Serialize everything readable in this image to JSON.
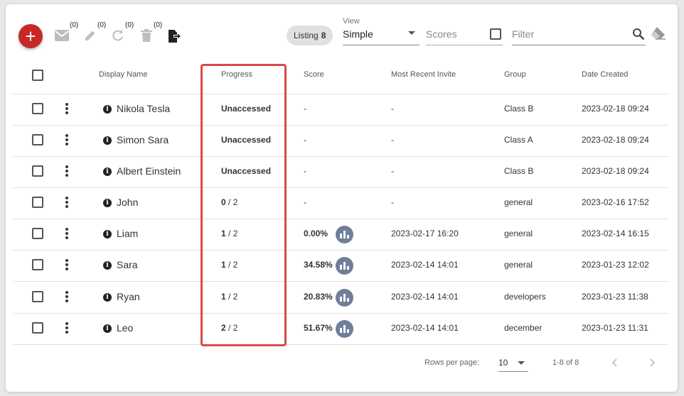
{
  "toolbar": {
    "add_label": "+",
    "email_count": "(0)",
    "edit_count": "(0)",
    "retry_count": "(0)",
    "delete_count": "(0)",
    "listing_label": "Listing",
    "listing_count": "8",
    "view_label": "View",
    "view_value": "Simple",
    "scores_placeholder": "Scores",
    "filter_placeholder": "Filter"
  },
  "table": {
    "headers": {
      "display_name": "Display Name",
      "progress": "Progress",
      "score": "Score",
      "most_recent_invite": "Most Recent Invite",
      "group": "Group",
      "date_created": "Date Created"
    },
    "rows": [
      {
        "name": "Nikola Tesla",
        "progress_done": "Unaccessed",
        "progress_total": "",
        "score": "-",
        "invite": "-",
        "group": "Class B",
        "created": "2023-02-18 09:24"
      },
      {
        "name": "Simon Sara",
        "progress_done": "Unaccessed",
        "progress_total": "",
        "score": "-",
        "invite": "-",
        "group": "Class A",
        "created": "2023-02-18 09:24"
      },
      {
        "name": "Albert Einstein",
        "progress_done": "Unaccessed",
        "progress_total": "",
        "score": "-",
        "invite": "-",
        "group": "Class B",
        "created": "2023-02-18 09:24"
      },
      {
        "name": "John",
        "progress_done": "0",
        "progress_total": " / 2",
        "score": "-",
        "invite": "-",
        "group": "general",
        "created": "2023-02-16 17:52"
      },
      {
        "name": "Liam",
        "progress_done": "1",
        "progress_total": " / 2",
        "score": "0.00%",
        "invite": "2023-02-17 16:20",
        "group": "general",
        "created": "2023-02-14 16:15"
      },
      {
        "name": "Sara",
        "progress_done": "1",
        "progress_total": " / 2",
        "score": "34.58%",
        "invite": "2023-02-14 14:01",
        "group": "general",
        "created": "2023-01-23 12:02"
      },
      {
        "name": "Ryan",
        "progress_done": "1",
        "progress_total": " / 2",
        "score": "20.83%",
        "invite": "2023-02-14 14:01",
        "group": "developers",
        "created": "2023-01-23 11:38"
      },
      {
        "name": "Leo",
        "progress_done": "2",
        "progress_total": " / 2",
        "score": "51.67%",
        "invite": "2023-02-14 14:01",
        "group": "december",
        "created": "2023-01-23 11:31"
      }
    ]
  },
  "footer": {
    "rows_per_page_label": "Rows per page:",
    "rows_per_page_value": "10",
    "range_label": "1-8 of 8"
  },
  "colors": {
    "accent_red": "#c62828",
    "highlight_border": "#d94a4a",
    "stat_icon": "#6f7f9a"
  }
}
